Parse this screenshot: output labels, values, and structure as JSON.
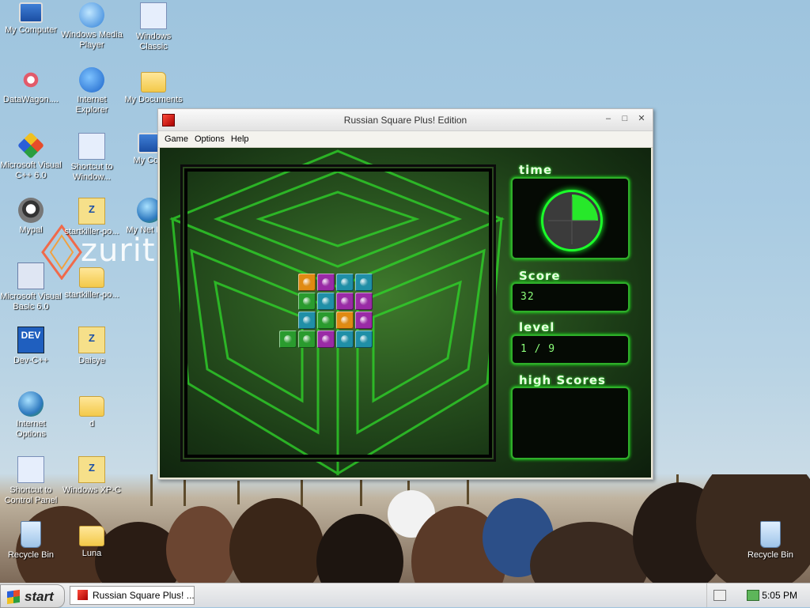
{
  "desktop": {
    "icons": [
      {
        "label": "My Computer",
        "icon": "my-computer-icon"
      },
      {
        "label": "Windows Media Player",
        "icon": "media-player-icon"
      },
      {
        "label": "Windows Classic",
        "icon": "windows-classic-icon"
      },
      {
        "label": "DataWagon....",
        "icon": "datawagon-icon"
      },
      {
        "label": "Internet Explorer",
        "icon": "internet-explorer-icon"
      },
      {
        "label": "My Documents",
        "icon": "my-documents-icon"
      },
      {
        "label": "Microsoft Visual C++ 6.0",
        "icon": "visual-cpp-icon"
      },
      {
        "label": "Shortcut to Window...",
        "icon": "shortcut-window-icon"
      },
      {
        "label": "My Com",
        "icon": "my-computer-icon"
      },
      {
        "label": "Mypal",
        "icon": "mypal-icon"
      },
      {
        "label": "startkiller-po...",
        "icon": "zip-folder-icon"
      },
      {
        "label": "My Net Plac",
        "icon": "network-places-icon"
      },
      {
        "label": "Microsoft Visual Basic 6.0",
        "icon": "visual-basic-icon"
      },
      {
        "label": "startkiller-po...",
        "icon": "folder-icon"
      },
      {
        "label": "Dev-C++",
        "icon": "dev-cpp-icon"
      },
      {
        "label": "Daisye",
        "icon": "zip-folder-icon"
      },
      {
        "label": "Internet Options",
        "icon": "internet-options-icon"
      },
      {
        "label": "d",
        "icon": "folder-icon"
      },
      {
        "label": "Shortcut to Control Panel",
        "icon": "control-panel-icon"
      },
      {
        "label": "Windows XP-C",
        "icon": "zip-folder-icon"
      },
      {
        "label": "Recycle Bin",
        "icon": "recycle-bin-icon"
      },
      {
        "label": "Luna",
        "icon": "folder-icon"
      },
      {
        "label": "Recycle Bin",
        "icon": "recycle-bin-icon"
      }
    ],
    "wallpaper_logo": "zurit"
  },
  "window": {
    "title": "Russian Square Plus! Edition",
    "menu": [
      "Game",
      "Options",
      "Help"
    ]
  },
  "game": {
    "time_label": "time",
    "score_label": "Score",
    "score": "32",
    "level_label": "level",
    "level": "1 / 9",
    "high_scores_label": "high Scores",
    "timer_fraction_remaining": 0.25,
    "colors": {
      "orange": "#e08a12",
      "purple": "#9a2aa6",
      "cyan": "#1f8fa7",
      "green": "#2a9b2e",
      "neon": "#1bff2a"
    },
    "board_rows": [
      [
        "orange",
        "purple",
        "cyan",
        "cyan"
      ],
      [
        "green",
        "cyan",
        "purple",
        "purple"
      ],
      [
        "cyan",
        "green",
        "orange",
        "purple"
      ],
      [
        "green",
        "green",
        "purple",
        "cyan",
        "cyan"
      ]
    ]
  },
  "taskbar": {
    "start_label": "start",
    "task_label": "Russian Square Plus! ...",
    "clock": "5:05 PM"
  }
}
